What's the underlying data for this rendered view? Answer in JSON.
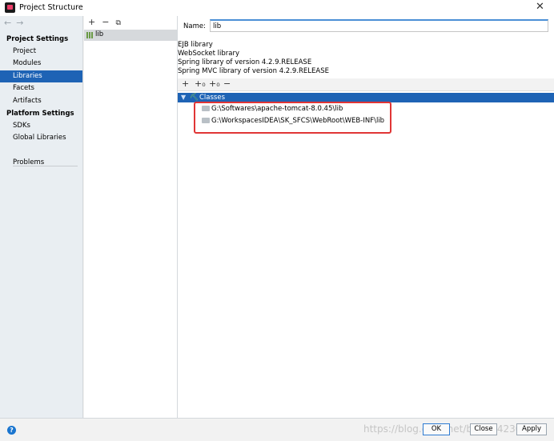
{
  "window": {
    "title": "Project Structure"
  },
  "nav": {
    "back_arrow": "←",
    "forward_arrow": "→",
    "project_settings_header": "Project Settings",
    "project_items": [
      "Project",
      "Modules",
      "Libraries",
      "Facets",
      "Artifacts"
    ],
    "selected": "Libraries",
    "platform_settings_header": "Platform Settings",
    "platform_items": [
      "SDKs",
      "Global Libraries"
    ],
    "problems": "Problems"
  },
  "library_list": {
    "add": "+",
    "remove": "−",
    "copy": "⧉",
    "items": [
      "lib"
    ]
  },
  "library_detail": {
    "name_label": "Name:",
    "name_value": "lib",
    "types": [
      "EJB library",
      "WebSocket library",
      "Spring library of version 4.2.9.RELEASE",
      "Spring MVC library of version 4.2.9.RELEASE"
    ],
    "roots_toolbar": {
      "add": "+",
      "add_classes": "+₀",
      "add_alt": "+₀",
      "remove": "−"
    },
    "classes_label": "Classes",
    "paths": [
      "G:\\Softwares\\apache-tomcat-8.0.45\\lib",
      "G:\\WorkspacesIDEA\\SK_SFCS\\WebRoot\\WEB-INF\\lib"
    ]
  },
  "footer": {
    "help": "?",
    "ok": "OK",
    "close": "Close",
    "apply": "Apply",
    "watermark": "https://blog.csdn.net/bakert4230"
  },
  "colors": {
    "selection": "#1e63b5",
    "highlight_box": "#e03535"
  }
}
